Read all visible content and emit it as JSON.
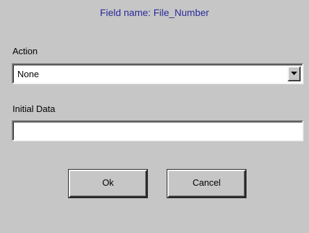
{
  "dialog": {
    "title": "Field name: File_Number",
    "action_label": "Action",
    "action_value": "None",
    "initial_data_label": "Initial Data",
    "initial_data_value": "",
    "ok_label": "Ok",
    "cancel_label": "Cancel"
  },
  "colors": {
    "background": "#c6c6c6",
    "title_text": "#2a2a9a"
  },
  "icons": {
    "combo_arrow": "chevron-down-icon"
  }
}
